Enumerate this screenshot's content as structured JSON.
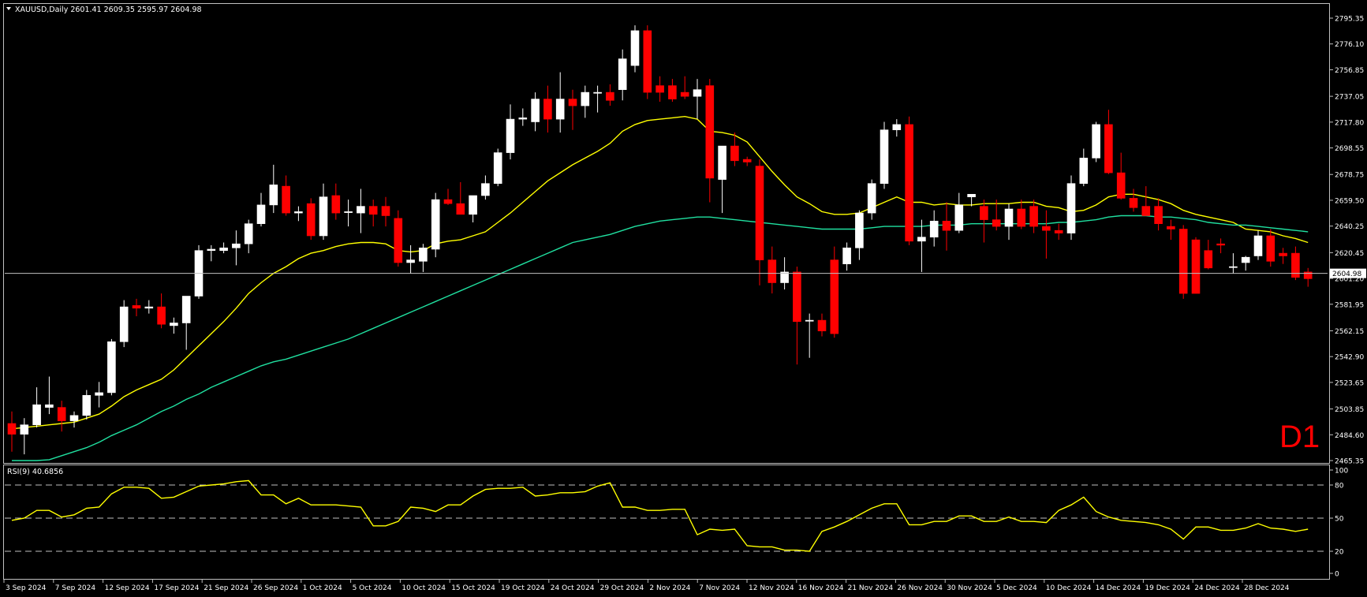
{
  "header": {
    "symbol_line": "XAUUSD,Daily  2601.41 2609.35 2595.97 2604.98",
    "timeframe_badge": "D1"
  },
  "colors": {
    "background": "#000000",
    "frame": "#c0c0c0",
    "bull_candle": "#ffffff",
    "bear_candle": "#ff0000",
    "ma_fast": "#ffff00",
    "ma_slow": "#20e0a0",
    "rsi_line": "#ffff00",
    "price_line": "#c0c0c0",
    "badge": "#ff0000"
  },
  "chart_data": [
    {
      "type": "candlestick",
      "title": "XAUUSD,Daily",
      "last_ohlc": {
        "open": 2601.41,
        "high": 2609.35,
        "low": 2595.97,
        "close": 2604.98
      },
      "current_price_label": "2604.98",
      "y_ticks": [
        "2795.35",
        "2776.10",
        "2756.85",
        "2737.05",
        "2717.80",
        "2698.55",
        "2678.75",
        "2659.50",
        "2640.25",
        "2620.45",
        "2601.20",
        "2581.95",
        "2562.15",
        "2542.90",
        "2523.65",
        "2503.85",
        "2484.60",
        "2465.35"
      ],
      "x_ticks": [
        "3 Sep 2024",
        "7 Sep 2024",
        "12 Sep 2024",
        "17 Sep 2024",
        "21 Sep 2024",
        "26 Sep 2024",
        "1 Oct 2024",
        "5 Oct 2024",
        "10 Oct 2024",
        "15 Oct 2024",
        "19 Oct 2024",
        "24 Oct 2024",
        "29 Oct 2024",
        "2 Nov 2024",
        "7 Nov 2024",
        "12 Nov 2024",
        "16 Nov 2024",
        "21 Nov 2024",
        "26 Nov 2024",
        "30 Nov 2024",
        "5 Dec 2024",
        "10 Dec 2024",
        "14 Dec 2024",
        "19 Dec 2024",
        "24 Dec 2024",
        "28 Dec 2024"
      ],
      "ylim": [
        2465.35,
        2800
      ],
      "candles": [
        {
          "o": 2493,
          "h": 2502,
          "l": 2472,
          "c": 2485
        },
        {
          "o": 2485,
          "h": 2497,
          "l": 2470,
          "c": 2492
        },
        {
          "o": 2492,
          "h": 2520,
          "l": 2490,
          "c": 2507
        },
        {
          "o": 2505,
          "h": 2528,
          "l": 2500,
          "c": 2507
        },
        {
          "o": 2505,
          "h": 2510,
          "l": 2487,
          "c": 2495
        },
        {
          "o": 2495,
          "h": 2502,
          "l": 2490,
          "c": 2499
        },
        {
          "o": 2499,
          "h": 2518,
          "l": 2496,
          "c": 2514
        },
        {
          "o": 2514,
          "h": 2524,
          "l": 2505,
          "c": 2516
        },
        {
          "o": 2516,
          "h": 2556,
          "l": 2514,
          "c": 2554
        },
        {
          "o": 2554,
          "h": 2585,
          "l": 2550,
          "c": 2580
        },
        {
          "o": 2581,
          "h": 2586,
          "l": 2573,
          "c": 2579
        },
        {
          "o": 2579,
          "h": 2585,
          "l": 2575,
          "c": 2580
        },
        {
          "o": 2580,
          "h": 2590,
          "l": 2564,
          "c": 2567
        },
        {
          "o": 2566,
          "h": 2572,
          "l": 2560,
          "c": 2568
        },
        {
          "o": 2568,
          "h": 2585,
          "l": 2548,
          "c": 2588
        },
        {
          "o": 2588,
          "h": 2626,
          "l": 2586,
          "c": 2622
        },
        {
          "o": 2622,
          "h": 2626,
          "l": 2614,
          "c": 2623
        },
        {
          "o": 2622,
          "h": 2628,
          "l": 2620,
          "c": 2624
        },
        {
          "o": 2624,
          "h": 2637,
          "l": 2611,
          "c": 2627
        },
        {
          "o": 2627,
          "h": 2645,
          "l": 2620,
          "c": 2642
        },
        {
          "o": 2642,
          "h": 2665,
          "l": 2640,
          "c": 2656
        },
        {
          "o": 2656,
          "h": 2686,
          "l": 2650,
          "c": 2671
        },
        {
          "o": 2670,
          "h": 2678,
          "l": 2648,
          "c": 2650
        },
        {
          "o": 2650,
          "h": 2655,
          "l": 2644,
          "c": 2651
        },
        {
          "o": 2657,
          "h": 2661,
          "l": 2630,
          "c": 2633
        },
        {
          "o": 2633,
          "h": 2672,
          "l": 2630,
          "c": 2662
        },
        {
          "o": 2663,
          "h": 2672,
          "l": 2645,
          "c": 2650
        },
        {
          "o": 2651,
          "h": 2660,
          "l": 2640,
          "c": 2651
        },
        {
          "o": 2650,
          "h": 2668,
          "l": 2635,
          "c": 2655
        },
        {
          "o": 2655,
          "h": 2660,
          "l": 2640,
          "c": 2649
        },
        {
          "o": 2655,
          "h": 2662,
          "l": 2640,
          "c": 2648
        },
        {
          "o": 2646,
          "h": 2652,
          "l": 2610,
          "c": 2613
        },
        {
          "o": 2613,
          "h": 2626,
          "l": 2605,
          "c": 2615
        },
        {
          "o": 2614,
          "h": 2627,
          "l": 2606,
          "c": 2624
        },
        {
          "o": 2623,
          "h": 2665,
          "l": 2617,
          "c": 2660
        },
        {
          "o": 2660,
          "h": 2668,
          "l": 2656,
          "c": 2657
        },
        {
          "o": 2657,
          "h": 2673,
          "l": 2650,
          "c": 2649
        },
        {
          "o": 2649,
          "h": 2663,
          "l": 2643,
          "c": 2663
        },
        {
          "o": 2663,
          "h": 2678,
          "l": 2660,
          "c": 2672
        },
        {
          "o": 2672,
          "h": 2698,
          "l": 2670,
          "c": 2695
        },
        {
          "o": 2695,
          "h": 2731,
          "l": 2690,
          "c": 2720
        },
        {
          "o": 2720,
          "h": 2728,
          "l": 2715,
          "c": 2721
        },
        {
          "o": 2718,
          "h": 2740,
          "l": 2711,
          "c": 2735
        },
        {
          "o": 2735,
          "h": 2745,
          "l": 2710,
          "c": 2720
        },
        {
          "o": 2720,
          "h": 2755,
          "l": 2710,
          "c": 2735
        },
        {
          "o": 2735,
          "h": 2742,
          "l": 2712,
          "c": 2730
        },
        {
          "o": 2730,
          "h": 2745,
          "l": 2721,
          "c": 2740
        },
        {
          "o": 2740,
          "h": 2745,
          "l": 2725,
          "c": 2740
        },
        {
          "o": 2740,
          "h": 2746,
          "l": 2730,
          "c": 2734
        },
        {
          "o": 2742,
          "h": 2772,
          "l": 2734,
          "c": 2765
        },
        {
          "o": 2760,
          "h": 2790,
          "l": 2755,
          "c": 2786
        },
        {
          "o": 2786,
          "h": 2790,
          "l": 2735,
          "c": 2740
        },
        {
          "o": 2745,
          "h": 2752,
          "l": 2733,
          "c": 2740
        },
        {
          "o": 2745,
          "h": 2750,
          "l": 2733,
          "c": 2735
        },
        {
          "o": 2740,
          "h": 2752,
          "l": 2735,
          "c": 2737
        },
        {
          "o": 2737,
          "h": 2750,
          "l": 2720,
          "c": 2742
        },
        {
          "o": 2745,
          "h": 2750,
          "l": 2658,
          "c": 2676
        },
        {
          "o": 2675,
          "h": 2700,
          "l": 2650,
          "c": 2700
        },
        {
          "o": 2700,
          "h": 2710,
          "l": 2685,
          "c": 2689
        },
        {
          "o": 2690,
          "h": 2692,
          "l": 2685,
          "c": 2688
        },
        {
          "o": 2685,
          "h": 2690,
          "l": 2596,
          "c": 2615
        },
        {
          "o": 2615,
          "h": 2625,
          "l": 2590,
          "c": 2598
        },
        {
          "o": 2598,
          "h": 2617,
          "l": 2593,
          "c": 2606
        },
        {
          "o": 2606,
          "h": 2610,
          "l": 2537,
          "c": 2569
        },
        {
          "o": 2570,
          "h": 2575,
          "l": 2542,
          "c": 2570
        },
        {
          "o": 2570,
          "h": 2575,
          "l": 2558,
          "c": 2562
        },
        {
          "o": 2615,
          "h": 2625,
          "l": 2557,
          "c": 2560
        },
        {
          "o": 2612,
          "h": 2628,
          "l": 2607,
          "c": 2624
        },
        {
          "o": 2624,
          "h": 2652,
          "l": 2615,
          "c": 2650
        },
        {
          "o": 2650,
          "h": 2675,
          "l": 2645,
          "c": 2672
        },
        {
          "o": 2672,
          "h": 2718,
          "l": 2668,
          "c": 2712
        },
        {
          "o": 2712,
          "h": 2720,
          "l": 2707,
          "c": 2716
        },
        {
          "o": 2716,
          "h": 2722,
          "l": 2626,
          "c": 2629
        },
        {
          "o": 2629,
          "h": 2645,
          "l": 2606,
          "c": 2632
        },
        {
          "o": 2632,
          "h": 2652,
          "l": 2625,
          "c": 2644
        },
        {
          "o": 2644,
          "h": 2658,
          "l": 2622,
          "c": 2637
        },
        {
          "o": 2637,
          "h": 2665,
          "l": 2635,
          "c": 2656
        },
        {
          "o": 2662,
          "h": 2664,
          "l": 2655,
          "c": 2664
        },
        {
          "o": 2655,
          "h": 2660,
          "l": 2628,
          "c": 2645
        },
        {
          "o": 2645,
          "h": 2660,
          "l": 2637,
          "c": 2640
        },
        {
          "o": 2640,
          "h": 2657,
          "l": 2630,
          "c": 2653
        },
        {
          "o": 2653,
          "h": 2660,
          "l": 2638,
          "c": 2640
        },
        {
          "o": 2655,
          "h": 2660,
          "l": 2635,
          "c": 2640
        },
        {
          "o": 2640,
          "h": 2652,
          "l": 2616,
          "c": 2637
        },
        {
          "o": 2637,
          "h": 2642,
          "l": 2630,
          "c": 2635
        },
        {
          "o": 2635,
          "h": 2678,
          "l": 2630,
          "c": 2672
        },
        {
          "o": 2672,
          "h": 2698,
          "l": 2670,
          "c": 2691
        },
        {
          "o": 2691,
          "h": 2718,
          "l": 2688,
          "c": 2716
        },
        {
          "o": 2716,
          "h": 2727,
          "l": 2679,
          "c": 2680
        },
        {
          "o": 2680,
          "h": 2695,
          "l": 2660,
          "c": 2661
        },
        {
          "o": 2661,
          "h": 2668,
          "l": 2651,
          "c": 2654
        },
        {
          "o": 2655,
          "h": 2670,
          "l": 2650,
          "c": 2648
        },
        {
          "o": 2655,
          "h": 2661,
          "l": 2637,
          "c": 2642
        },
        {
          "o": 2640,
          "h": 2645,
          "l": 2630,
          "c": 2638
        },
        {
          "o": 2638,
          "h": 2641,
          "l": 2586,
          "c": 2590
        },
        {
          "o": 2630,
          "h": 2632,
          "l": 2590,
          "c": 2590
        },
        {
          "o": 2622,
          "h": 2630,
          "l": 2608,
          "c": 2609
        },
        {
          "o": 2627,
          "h": 2631,
          "l": 2620,
          "c": 2626
        },
        {
          "o": 2610,
          "h": 2620,
          "l": 2605,
          "c": 2610
        },
        {
          "o": 2613,
          "h": 2618,
          "l": 2607,
          "c": 2617
        },
        {
          "o": 2618,
          "h": 2637,
          "l": 2615,
          "c": 2633
        },
        {
          "o": 2633,
          "h": 2638,
          "l": 2610,
          "c": 2614
        },
        {
          "o": 2620,
          "h": 2624,
          "l": 2612,
          "c": 2618
        },
        {
          "o": 2620,
          "h": 2625,
          "l": 2600,
          "c": 2602
        },
        {
          "o": 2606,
          "h": 2609,
          "l": 2595,
          "c": 2601
        }
      ],
      "series": [
        {
          "key": "ma_fast",
          "values": [
            2489,
            2490,
            2491,
            2492,
            2493,
            2494,
            2497,
            2500,
            2506,
            2513,
            2518,
            2522,
            2526,
            2533,
            2542,
            2551,
            2560,
            2569,
            2579,
            2590,
            2598,
            2605,
            2610,
            2616,
            2620,
            2622,
            2625,
            2627,
            2628,
            2628,
            2627,
            2622,
            2621,
            2622,
            2627,
            2629,
            2630,
            2633,
            2636,
            2643,
            2650,
            2658,
            2666,
            2674,
            2680,
            2686,
            2691,
            2696,
            2702,
            2711,
            2716,
            2719,
            2720,
            2721,
            2722,
            2720,
            2711,
            2710,
            2708,
            2703,
            2692,
            2681,
            2671,
            2662,
            2657,
            2651,
            2649,
            2649,
            2650,
            2654,
            2658,
            2662,
            2658,
            2658,
            2656,
            2657,
            2656,
            2656,
            2657,
            2657,
            2657,
            2658,
            2658,
            2655,
            2654,
            2651,
            2652,
            2656,
            2662,
            2664,
            2664,
            2662,
            2660,
            2657,
            2652,
            2649,
            2647,
            2645,
            2643,
            2638,
            2637,
            2636,
            2633,
            2631,
            2628
          ]
        },
        {
          "key": "ma_slow",
          "values": [
            2462,
            2463,
            2464,
            2466,
            2469,
            2472,
            2475,
            2479,
            2484,
            2488,
            2492,
            2497,
            2502,
            2506,
            2511,
            2515,
            2520,
            2524,
            2528,
            2532,
            2536,
            2539,
            2541,
            2544,
            2547,
            2550,
            2553,
            2556,
            2560,
            2564,
            2568,
            2572,
            2576,
            2580,
            2584,
            2588,
            2592,
            2596,
            2600,
            2604,
            2608,
            2612,
            2616,
            2620,
            2624,
            2628,
            2630,
            2632,
            2634,
            2637,
            2640,
            2642,
            2644,
            2645,
            2646,
            2647,
            2647,
            2646,
            2645,
            2644,
            2643,
            2642,
            2641,
            2640,
            2639,
            2638,
            2638,
            2638,
            2638,
            2639,
            2640,
            2640,
            2640,
            2640,
            2641,
            2641,
            2641,
            2642,
            2642,
            2642,
            2642,
            2642,
            2642,
            2642,
            2643,
            2643,
            2644,
            2645,
            2647,
            2648,
            2648,
            2648,
            2647,
            2647,
            2646,
            2645,
            2643,
            2642,
            2641,
            2641,
            2640,
            2639,
            2638,
            2637,
            2636
          ]
        }
      ]
    },
    {
      "type": "line",
      "title": "RSI(9) 40.6856",
      "y_ticks": [
        "100",
        "80",
        "50",
        "20",
        "0"
      ],
      "levels": [
        80,
        50,
        20
      ],
      "ylim": [
        0,
        100
      ],
      "series": [
        {
          "key": "rsi",
          "values": [
            48,
            50,
            57,
            57,
            51,
            53,
            59,
            60,
            72,
            78,
            78,
            77,
            68,
            69,
            74,
            79,
            80,
            81,
            83,
            84,
            71,
            71,
            63,
            68,
            62,
            62,
            62,
            61,
            60,
            43,
            43,
            47,
            60,
            59,
            56,
            62,
            62,
            70,
            76,
            77,
            77,
            78,
            70,
            71,
            73,
            73,
            74,
            79,
            82,
            60,
            60,
            57,
            57,
            58,
            58,
            35,
            40,
            39,
            40,
            25,
            24,
            24,
            21,
            21,
            20,
            38,
            42,
            47,
            53,
            59,
            63,
            63,
            44,
            44,
            47,
            47,
            52,
            52,
            47,
            47,
            51,
            47,
            47,
            46,
            57,
            62,
            69,
            56,
            51,
            48,
            47,
            46,
            44,
            40,
            31,
            42,
            42,
            39,
            39,
            41,
            45,
            41,
            40,
            38,
            40
          ]
        }
      ]
    }
  ]
}
